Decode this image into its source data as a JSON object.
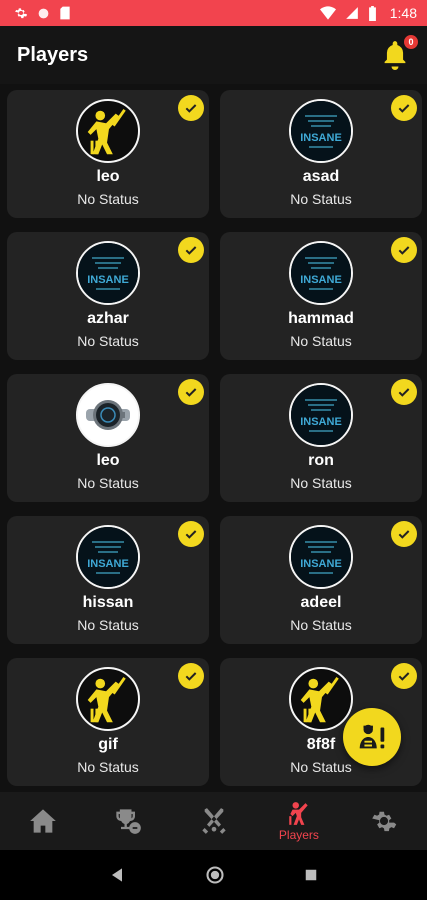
{
  "status_bar": {
    "time": "1:48",
    "left_icons": [
      "gear-icon",
      "circle-icon",
      "sd-card-icon"
    ],
    "right_icons": [
      "wifi-icon",
      "signal-icon",
      "battery-icon"
    ],
    "color": "#f2444e"
  },
  "header": {
    "title": "Players",
    "notification_count": "0"
  },
  "players": [
    {
      "name": "leo",
      "status": "No Status",
      "avatar": "cricket-batsman",
      "checked": true
    },
    {
      "name": "asad",
      "status": "No Status",
      "avatar": "insane-text",
      "checked": true
    },
    {
      "name": "azhar",
      "status": "No Status",
      "avatar": "insane-text",
      "checked": true
    },
    {
      "name": "hammad",
      "status": "No Status",
      "avatar": "insane-text",
      "checked": true
    },
    {
      "name": "leo",
      "status": "No Status",
      "avatar": "smartwatch",
      "checked": true
    },
    {
      "name": "ron",
      "status": "No Status",
      "avatar": "insane-text",
      "checked": true
    },
    {
      "name": "hissan",
      "status": "No Status",
      "avatar": "insane-text",
      "checked": true
    },
    {
      "name": "adeel",
      "status": "No Status",
      "avatar": "insane-text",
      "checked": true
    },
    {
      "name": "gif",
      "status": "No Status",
      "avatar": "cricket-batsman",
      "checked": true
    },
    {
      "name": "8f8f",
      "status": "No Status",
      "avatar": "cricket-batsman",
      "checked": true
    }
  ],
  "avatar_text": {
    "insane": "INSANE"
  },
  "fab": {
    "icon": "player-alert-icon"
  },
  "bottom_nav": {
    "items": [
      {
        "icon": "home-icon",
        "label": ""
      },
      {
        "icon": "trophy-icon",
        "label": ""
      },
      {
        "icon": "cricket-bats-icon",
        "label": ""
      },
      {
        "icon": "players-icon",
        "label": "Players",
        "active": true
      },
      {
        "icon": "settings-icon",
        "label": ""
      }
    ]
  },
  "colors": {
    "accent_yellow": "#f2d81e",
    "active_red": "#f2444e",
    "inactive_grey": "#8a8a8a",
    "card_bg": "#232323",
    "page_bg": "#111111"
  }
}
